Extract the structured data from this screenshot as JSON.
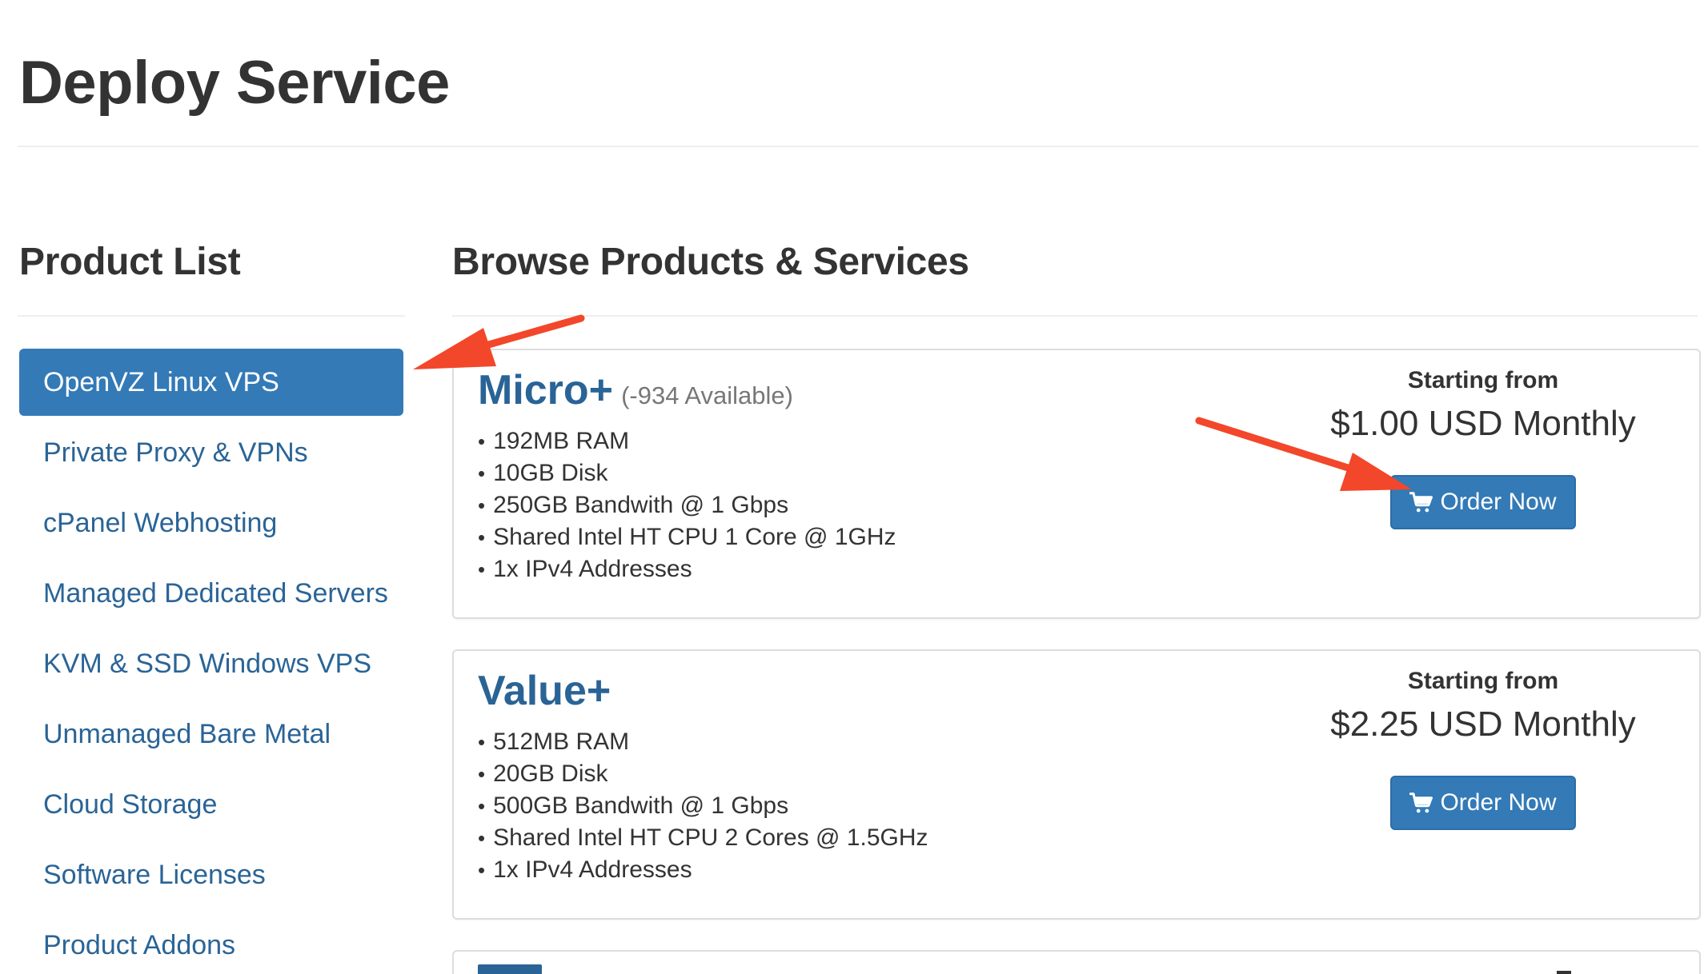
{
  "page": {
    "title": "Deploy Service"
  },
  "sidebar": {
    "heading": "Product List",
    "items": [
      {
        "label": "OpenVZ Linux VPS",
        "active": true
      },
      {
        "label": "Private Proxy & VPNs",
        "active": false
      },
      {
        "label": "cPanel Webhosting",
        "active": false
      },
      {
        "label": "Managed Dedicated Servers",
        "active": false
      },
      {
        "label": "KVM & SSD Windows VPS",
        "active": false
      },
      {
        "label": "Unmanaged Bare Metal",
        "active": false
      },
      {
        "label": "Cloud Storage",
        "active": false
      },
      {
        "label": "Software Licenses",
        "active": false
      },
      {
        "label": "Product Addons",
        "active": false
      }
    ]
  },
  "main": {
    "heading": "Browse Products & Services",
    "products": [
      {
        "name": "Micro+",
        "availability": "(-934 Available)",
        "features": [
          "192MB RAM",
          "10GB Disk",
          "250GB Bandwith @ 1 Gbps",
          "Shared Intel HT CPU 1 Core @ 1GHz",
          "1x IPv4 Addresses"
        ],
        "starting_label": "Starting from",
        "price": "$1.00 USD Monthly",
        "order_label": "Order Now"
      },
      {
        "name": "Value+",
        "features": [
          "512MB RAM",
          "20GB Disk",
          "500GB Bandwith @ 1 Gbps",
          "Shared Intel HT CPU 2 Cores @ 1.5GHz",
          "1x IPv4 Addresses"
        ],
        "starting_label": "Starting from",
        "price": "$2.25 USD Monthly",
        "order_label": "Order Now"
      }
    ]
  },
  "colors": {
    "accent": "#337ab7",
    "link": "#2a6496",
    "annotation_arrow": "#f2472a"
  },
  "icons": {
    "cart": "shopping-cart-icon"
  }
}
